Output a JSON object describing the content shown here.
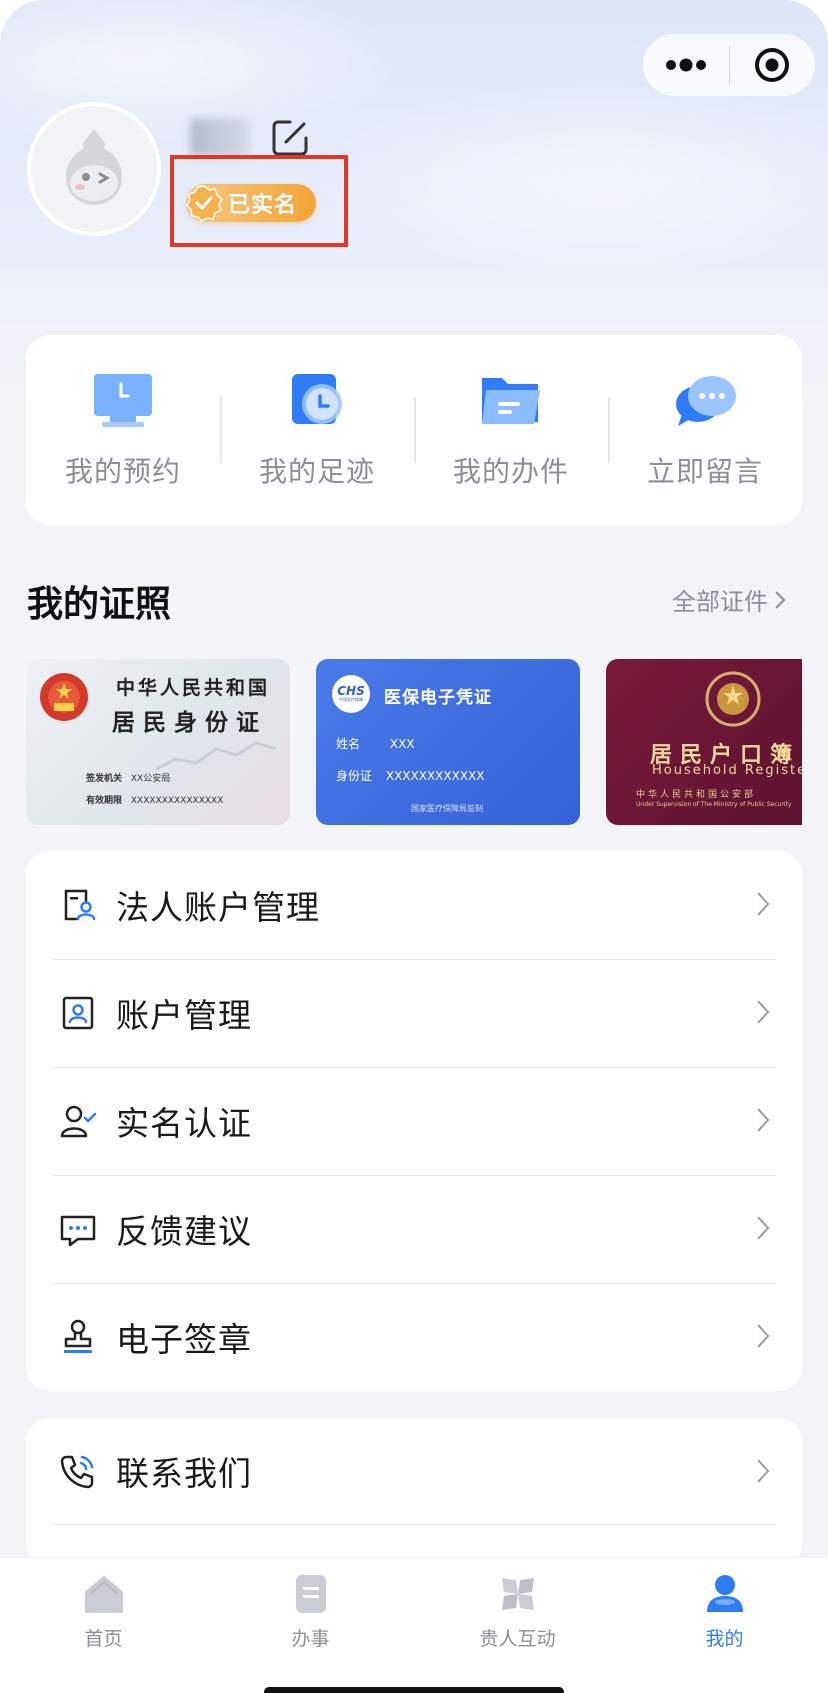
{
  "profile": {
    "username": "",
    "verified_badge": "已实名",
    "icons": [
      "avatar-mascot",
      "edit-icon",
      "verified-check-icon"
    ]
  },
  "capsule": {
    "more_icon": "more-dots-icon",
    "close_icon": "target-close-icon"
  },
  "quick_actions": [
    {
      "label": "我的预约",
      "icon": "calendar-clock-icon"
    },
    {
      "label": "我的足迹",
      "icon": "clock-doc-icon"
    },
    {
      "label": "我的办件",
      "icon": "folder-icon"
    },
    {
      "label": "立即留言",
      "icon": "chat-bubbles-icon"
    }
  ],
  "licenses_section": {
    "title": "我的证照",
    "more_label": "全部证件",
    "cards": [
      {
        "type": "resident-id",
        "title_line1": "中华人民共和国",
        "title_line2": "居民身份证",
        "field1_label": "签发机关",
        "field1_value": "XX公安局",
        "field2_label": "有效期限",
        "field2_value": "XXXXXXXXXXXXXXX"
      },
      {
        "type": "medical-insurance",
        "logo": "CHS",
        "logo_sub": "中国医疗保障",
        "title": "医保电子凭证",
        "name_label": "姓名",
        "name_value": "XXX",
        "id_label": "身份证",
        "id_value": "XXXXXXXXXXXX",
        "footer": "国家医疗保障局监制"
      },
      {
        "type": "household-register",
        "title_cn": "居民户口簿",
        "title_en": "Household Register",
        "sub_cn": "中华人民共和国公安部",
        "sub_en": "Under Supervision of The Ministry of Public Security"
      }
    ]
  },
  "menu_main": [
    {
      "label": "法人账户管理",
      "icon": "corporate-account-icon"
    },
    {
      "label": "账户管理",
      "icon": "account-card-icon"
    },
    {
      "label": "实名认证",
      "icon": "user-check-icon"
    },
    {
      "label": "反馈建议",
      "icon": "feedback-icon"
    },
    {
      "label": "电子签章",
      "icon": "stamp-icon"
    }
  ],
  "menu_secondary": [
    {
      "label": "联系我们",
      "icon": "phone-icon"
    }
  ],
  "tabbar": [
    {
      "label": "首页",
      "icon": "home-icon",
      "active": false
    },
    {
      "label": "办事",
      "icon": "doc-icon",
      "active": false
    },
    {
      "label": "贵人互动",
      "icon": "interaction-icon",
      "active": false
    },
    {
      "label": "我的",
      "icon": "user-icon",
      "active": true
    }
  ],
  "colors": {
    "accent": "#2F7CF6",
    "badge": "#F2A437",
    "highlight_box": "#E53524",
    "text_muted": "#8A8F99"
  }
}
